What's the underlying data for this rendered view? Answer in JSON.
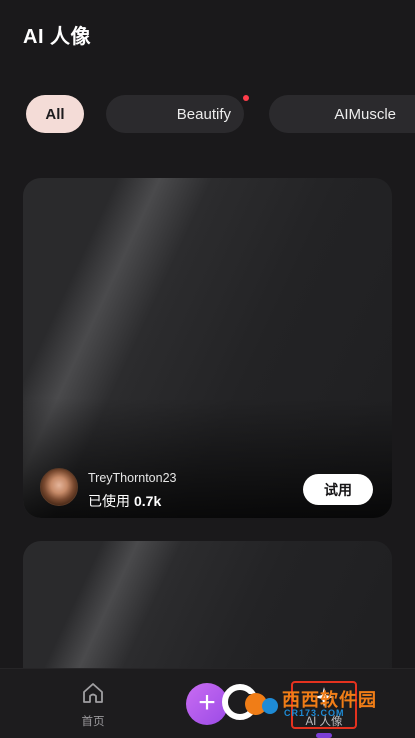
{
  "header": {
    "title": "AI 人像"
  },
  "chips": [
    {
      "label": "All",
      "selected": true
    },
    {
      "label": "Beautify",
      "has_dot": true
    },
    {
      "label": "AIMuscle"
    }
  ],
  "cards": [
    {
      "author": "TreyThornton23",
      "usage_prefix": "已使用",
      "usage_count": "0.7k",
      "action_label": "试用"
    },
    {}
  ],
  "bottom_nav": {
    "home_label": "首页",
    "create_symbol": "+",
    "ai_label": "AI 人像",
    "active_tab": "ai"
  },
  "watermark": {
    "text": "西西软件园",
    "url": "CR173.COM"
  },
  "colors": {
    "background": "#1a191b",
    "chip_selected": "#f4dcd7",
    "notification_dot": "#ff3d4b",
    "fab": "#b15cec",
    "highlight_box": "#e4321f"
  }
}
